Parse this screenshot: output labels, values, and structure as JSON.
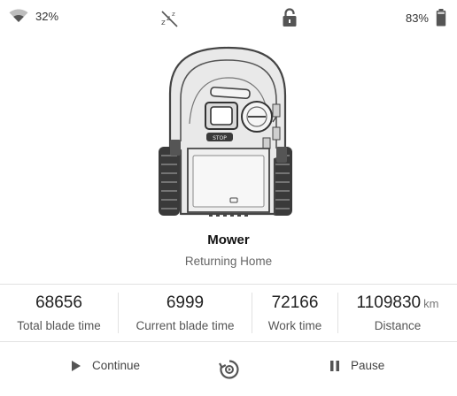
{
  "status_bar": {
    "wifi_signal": "32%",
    "battery_level": "83%",
    "icons": [
      "wifi-icon",
      "sleep-icon",
      "lock-icon",
      "battery-icon"
    ]
  },
  "device": {
    "name": "Mower",
    "status": "Returning Home",
    "image": "robotic-mower-illustration"
  },
  "stats": [
    {
      "value": "68656",
      "unit": "",
      "label": "Total blade time"
    },
    {
      "value": "6999",
      "unit": "",
      "label": "Current blade time"
    },
    {
      "value": "72166",
      "unit": "",
      "label": "Work time"
    },
    {
      "value": "1109830",
      "unit": "km",
      "label": "Distance"
    }
  ],
  "actions": {
    "continue_label": "Continue",
    "pause_label": "Pause",
    "center_icon": "return-to-base-icon"
  }
}
